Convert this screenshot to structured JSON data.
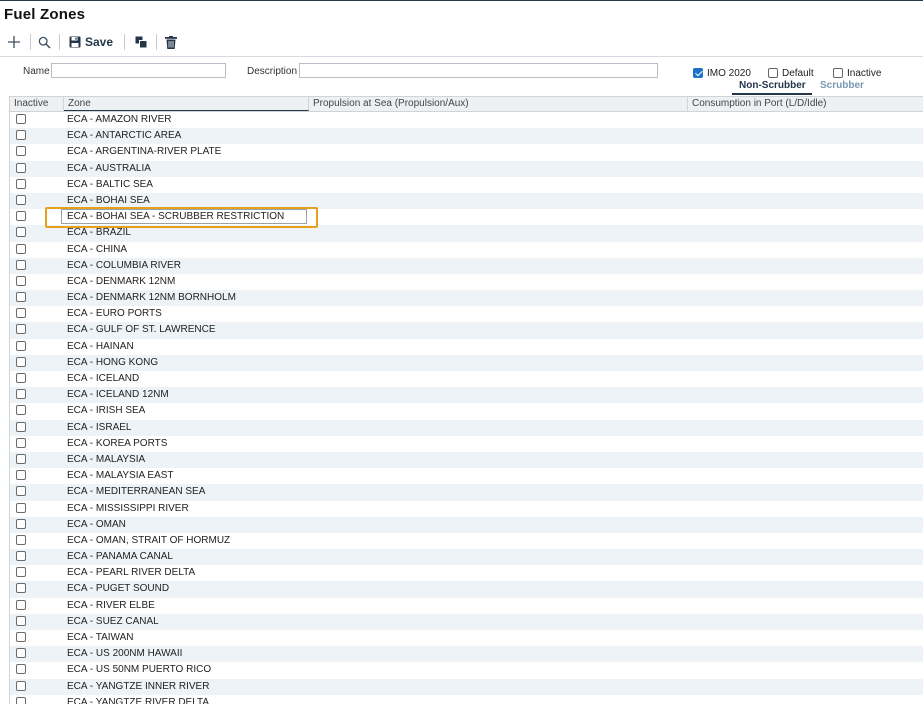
{
  "page": {
    "title": "Fuel Zones"
  },
  "toolbar": {
    "add_icon": "plus-icon",
    "search_icon": "search-icon",
    "save_label": "Save",
    "copy_icon": "copy-icon",
    "delete_icon": "trash-icon"
  },
  "filters": {
    "name_label": "Name",
    "name_value": "",
    "description_label": "Description",
    "description_value": "",
    "imo2020_label": "IMO 2020",
    "imo2020_checked": true,
    "default_label": "Default",
    "default_checked": false,
    "inactive_label": "Inactive",
    "inactive_checked": false,
    "tabs": [
      "Non-Scrubber",
      "Scrubber"
    ],
    "active_tab": "Non-Scrubber"
  },
  "grid": {
    "columns": [
      "Inactive",
      "Zone",
      "Propulsion at Sea (Propulsion/Aux)",
      "Consumption in Port (L/D/Idle)"
    ],
    "selected_index": 6,
    "rows": [
      "ECA - AMAZON RIVER",
      "ECA - ANTARCTIC AREA",
      "ECA - ARGENTINA-RIVER PLATE",
      "ECA - AUSTRALIA",
      "ECA - BALTIC SEA",
      "ECA - BOHAI SEA",
      "ECA - BOHAI SEA - SCRUBBER RESTRICTION",
      "ECA - BRAZIL",
      "ECA - CHINA",
      "ECA - COLUMBIA RIVER",
      "ECA - DENMARK 12NM",
      "ECA - DENMARK 12NM BORNHOLM",
      "ECA - EURO PORTS",
      "ECA - GULF OF ST. LAWRENCE",
      "ECA - HAINAN",
      "ECA - HONG KONG",
      "ECA - ICELAND",
      "ECA - ICELAND 12NM",
      "ECA - IRISH SEA",
      "ECA - ISRAEL",
      "ECA - KOREA PORTS",
      "ECA - MALAYSIA",
      "ECA - MALAYSIA EAST",
      "ECA - MEDITERRANEAN SEA",
      "ECA - MISSISSIPPI RIVER",
      "ECA - OMAN",
      "ECA - OMAN, STRAIT OF HORMUZ",
      "ECA - PANAMA CANAL",
      "ECA - PEARL RIVER DELTA",
      "ECA - PUGET SOUND",
      "ECA - RIVER ELBE",
      "ECA - SUEZ CANAL",
      "ECA - TAIWAN",
      "ECA - US 200NM HAWAII",
      "ECA - US 50NM PUERTO RICO",
      "ECA - YANGTZE INNER RIVER",
      "ECA - YANGTZE RIVER DELTA"
    ]
  },
  "colors": {
    "accent": "#1a73c9",
    "tab_active": "#24364a",
    "tab_inactive": "#7a97b0",
    "highlight": "#e5a11b",
    "row_alt": "#edf3f6"
  }
}
